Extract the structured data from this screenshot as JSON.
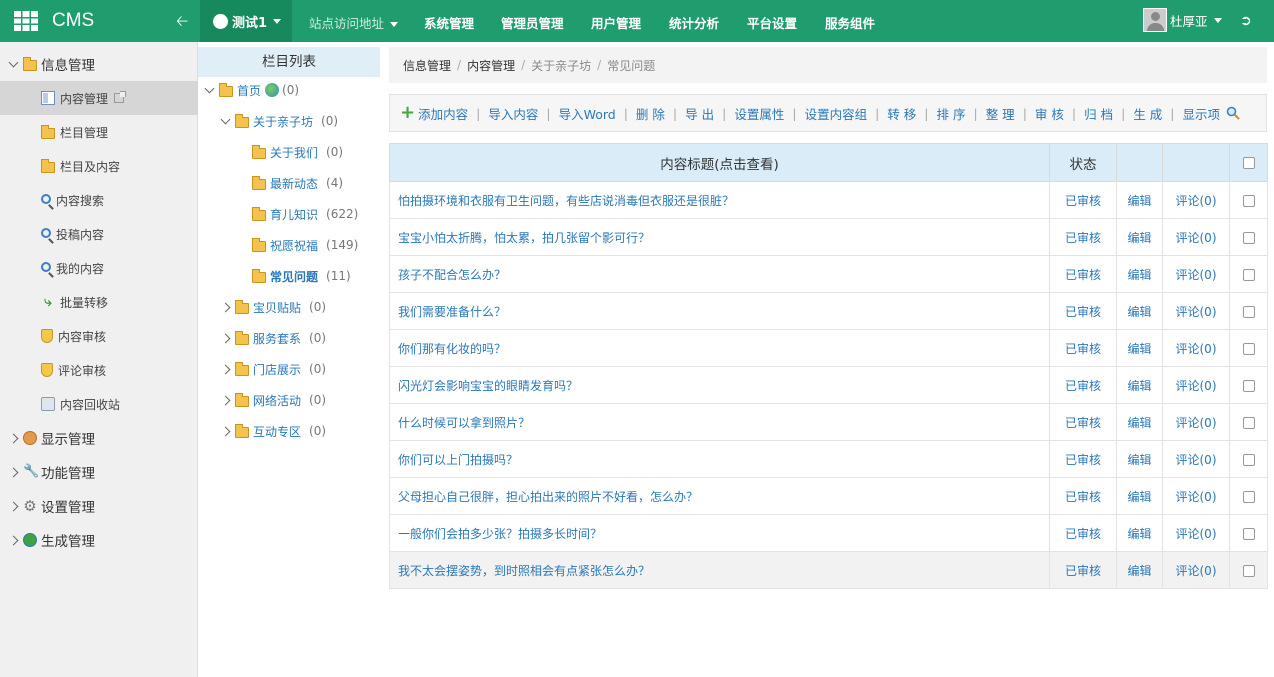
{
  "topbar": {
    "brand": "CMS",
    "site_label": "测试1",
    "nav": [
      "站点访问地址",
      "系统管理",
      "管理员管理",
      "用户管理",
      "统计分析",
      "平台设置",
      "服务组件"
    ],
    "user_name": "杜厚亚"
  },
  "sidebar": {
    "groups": [
      {
        "label": "信息管理",
        "icon": "folder-icon",
        "expanded": true
      },
      {
        "label": "显示管理",
        "icon": "palette-icon",
        "expanded": false
      },
      {
        "label": "功能管理",
        "icon": "wrench-icon",
        "expanded": false
      },
      {
        "label": "设置管理",
        "icon": "gear-icon",
        "expanded": false
      },
      {
        "label": "生成管理",
        "icon": "earth-icon",
        "expanded": false
      }
    ],
    "items": [
      {
        "label": "内容管理",
        "icon": "document-icon",
        "active": true
      },
      {
        "label": "栏目管理",
        "icon": "folder-icon"
      },
      {
        "label": "栏目及内容",
        "icon": "folder-icon"
      },
      {
        "label": "内容搜索",
        "icon": "search-icon"
      },
      {
        "label": "投稿内容",
        "icon": "search-icon"
      },
      {
        "label": "我的内容",
        "icon": "search-icon"
      },
      {
        "label": "批量转移",
        "icon": "arrow-icon"
      },
      {
        "label": "内容审核",
        "icon": "shield-icon"
      },
      {
        "label": "评论审核",
        "icon": "shield-icon"
      },
      {
        "label": "内容回收站",
        "icon": "recycle-bin-icon"
      }
    ]
  },
  "tree": {
    "header": "栏目列表",
    "root": {
      "label": "首页",
      "count": "(0)"
    },
    "nodes": [
      {
        "label": "关于亲子坊",
        "count": "(0)",
        "level": 1,
        "expanded": true
      },
      {
        "label": "关于我们",
        "count": "(0)",
        "level": 2
      },
      {
        "label": "最新动态",
        "count": "(4)",
        "level": 2
      },
      {
        "label": "育儿知识",
        "count": "(622)",
        "level": 2
      },
      {
        "label": "祝愿祝福",
        "count": "(149)",
        "level": 2
      },
      {
        "label": "常见问题",
        "count": "(11)",
        "level": 2,
        "current": true
      },
      {
        "label": "宝贝贴贴",
        "count": "(0)",
        "level": 1
      },
      {
        "label": "服务套系",
        "count": "(0)",
        "level": 1
      },
      {
        "label": "门店展示",
        "count": "(0)",
        "level": 1
      },
      {
        "label": "网络活动",
        "count": "(0)",
        "level": 1
      },
      {
        "label": "互动专区",
        "count": "(0)",
        "level": 1
      }
    ]
  },
  "breadcrumb": [
    "信息管理",
    "内容管理",
    "关于亲子坊",
    "常见问题"
  ],
  "toolbar": [
    "添加内容",
    "导入内容",
    "导入Word",
    "删 除",
    "导 出",
    "设置属性",
    "设置内容组",
    "转 移",
    "排 序",
    "整 理",
    "审 核",
    "归 档",
    "生 成",
    "显示项"
  ],
  "table": {
    "headers": {
      "title": "内容标题(点击查看)",
      "status": "状态"
    },
    "rows": [
      {
        "title": "怕拍摄环境和衣服有卫生问题，有些店说消毒但衣服还是很脏？",
        "status": "已审核",
        "edit": "编辑",
        "comment": "评论(0)"
      },
      {
        "title": "宝宝小怕太折腾，怕太累，拍几张留个影可行？",
        "status": "已审核",
        "edit": "编辑",
        "comment": "评论(0)"
      },
      {
        "title": "孩子不配合怎么办？",
        "status": "已审核",
        "edit": "编辑",
        "comment": "评论(0)"
      },
      {
        "title": "我们需要准备什么？",
        "status": "已审核",
        "edit": "编辑",
        "comment": "评论(0)"
      },
      {
        "title": "你们那有化妆的吗？",
        "status": "已审核",
        "edit": "编辑",
        "comment": "评论(0)"
      },
      {
        "title": "闪光灯会影响宝宝的眼睛发育吗？",
        "status": "已审核",
        "edit": "编辑",
        "comment": "评论(0)"
      },
      {
        "title": "什么时候可以拿到照片？",
        "status": "已审核",
        "edit": "编辑",
        "comment": "评论(0)"
      },
      {
        "title": "你们可以上门拍摄吗？",
        "status": "已审核",
        "edit": "编辑",
        "comment": "评论(0)"
      },
      {
        "title": "父母担心自己很胖，担心拍出来的照片不好看，怎么办？",
        "status": "已审核",
        "edit": "编辑",
        "comment": "评论(0)"
      },
      {
        "title": "一般你们会拍多少张？拍摄多长时间？",
        "status": "已审核",
        "edit": "编辑",
        "comment": "评论(0)"
      },
      {
        "title": "我不太会摆姿势，到时照相会有点紧张怎么办？",
        "status": "已审核",
        "edit": "编辑",
        "comment": "评论(0)"
      }
    ]
  },
  "colors": {
    "header_green": "#1f9d6e",
    "link_blue": "#2a78b8",
    "table_header": "#d9ecf7"
  }
}
